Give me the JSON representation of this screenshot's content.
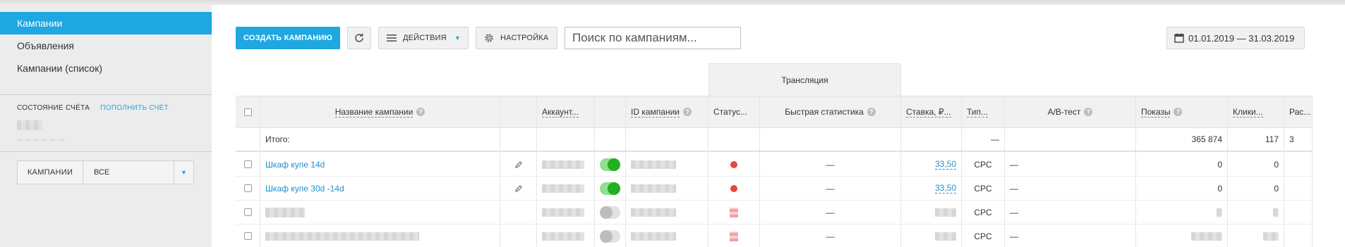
{
  "sidebar": {
    "items": [
      {
        "label": "Кампании",
        "active": true
      },
      {
        "label": "Объявления",
        "active": false
      },
      {
        "label": "Кампании (список)",
        "active": false
      }
    ],
    "account_state_label": "СОСТОЯНИЕ СЧЁТА",
    "top_up_label": "ПОПОЛНИТЬ СЧЁТ",
    "filter": {
      "label": "КАМПАНИИ",
      "value": "ВСЕ"
    }
  },
  "toolbar": {
    "create_label": "СОЗДАТЬ КАМПАНИЮ",
    "actions_label": "ДЕЙСТВИЯ",
    "settings_label": "НАСТРОЙКА",
    "search_placeholder": "Поиск по кампаниям...",
    "date_range": "01.01.2019 — 31.03.2019"
  },
  "table": {
    "group_header": "Трансляция",
    "columns": {
      "name": "Название кампании",
      "account": "Аккаунт...",
      "id": "ID кампании",
      "status": "Статус...",
      "quick_stats": "Быстрая статистика",
      "bid": "Ставка, ₽...",
      "type": "Тип...",
      "ab_test": "A/B-тест",
      "impressions": "Показы",
      "clicks": "Клики...",
      "spend": "Рас..."
    },
    "total": {
      "label": "Итого:",
      "type": "—",
      "impressions": "365 874",
      "clicks": "117",
      "spend": "3"
    },
    "rows": [
      {
        "name": "Шкаф купе 14d",
        "toggle": "on",
        "status_color": "#ea4444",
        "quick_stats": "—",
        "bid": "33,50",
        "type": "CPC",
        "ab_test": "—",
        "impressions": "0",
        "clicks": "0"
      },
      {
        "name": "Шкаф купе 30d -14d",
        "toggle": "on",
        "status_color": "#ea4444",
        "quick_stats": "—",
        "bid": "33,50",
        "type": "CPC",
        "ab_test": "—",
        "impressions": "0",
        "clicks": "0"
      },
      {
        "name": "",
        "toggle": "off",
        "quick_stats": "—",
        "type": "CPC",
        "ab_test": "—"
      },
      {
        "name": "",
        "toggle": "off",
        "quick_stats": "—",
        "type": "CPC",
        "ab_test": "—"
      }
    ]
  },
  "colors": {
    "accent": "#1ea7e1",
    "status_red": "#ea4444",
    "toggle_on": "#22b022"
  }
}
